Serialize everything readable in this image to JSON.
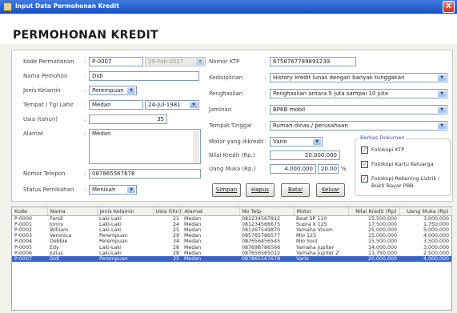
{
  "window": {
    "title": "Input Data Permohonan Kredit",
    "close_symbol": "X"
  },
  "page_title": "PERMOHONAN KREDIT",
  "left_form": {
    "kode": {
      "label": "Kode Permohonan",
      "value": "P-0007",
      "date_value": "25-Feb-2017"
    },
    "nama": {
      "label": "Nama Pemohon",
      "value": "Didi"
    },
    "jenis_kelamin": {
      "label": "Jenis Kelamin",
      "value": "Perempuan"
    },
    "ttl": {
      "label": "Tempat / Tgl Lahir",
      "tempat": "Medan",
      "tanggal": "24-Jul-1981"
    },
    "usia": {
      "label": "Usia (tahun)",
      "value": "35"
    },
    "alamat": {
      "label": "Alamat",
      "value": "Medan"
    },
    "telepon": {
      "label": "Nomor Telepon",
      "value": "087865567678"
    },
    "status": {
      "label": "Status Pernikahan",
      "value": "Menikah"
    }
  },
  "right_form": {
    "ktp": {
      "label": "Nomor KTP",
      "value": "6758767789891239"
    },
    "kedisiplinan": {
      "label": "Kedisiplinan",
      "value": "History kredit lunas dengan banyak tunggakan"
    },
    "penghasilan": {
      "label": "Penghasilan",
      "value": "Penghasilan antara 5 juta sampai 10 juta"
    },
    "jaminan": {
      "label": "Jaminan",
      "value": "BPKB mobil"
    },
    "tempat_tinggal": {
      "label": "Tempat Tinggal",
      "value": "Rumah dinas / perusahaan"
    },
    "motor": {
      "label": "Motor yang dikredit",
      "value": "Vario"
    },
    "nilai_kredit": {
      "label": "Nilai Kredit (Rp.)",
      "value": "20.000.000"
    },
    "uang_muka": {
      "label": "Uang Muka (Rp.)",
      "value": "4.000.000",
      "percent": "20.00",
      "percent_sign": "%"
    }
  },
  "buttons": {
    "simpan": "Simpan",
    "hapus": "Hapus",
    "batal": "Batal",
    "keluar": "Keluar"
  },
  "berkas": {
    "title": "Berkas Dokumen",
    "items": [
      {
        "label": "Fotokopi KTP",
        "checked": true
      },
      {
        "label": "Fotokopi Kartu Keluarga",
        "checked": true
      },
      {
        "label": "Fotokopi Rekening Listrik / Bukti Bayar PBB",
        "checked": true
      }
    ],
    "check_symbol": "✓"
  },
  "table": {
    "columns": [
      "Kode",
      "Nama",
      "Jenis Kelamin",
      "Usia (thn)",
      "Alamat",
      "No Telp",
      "Motor",
      "Nilai Kredit (Rp)",
      "Uang Muka (Rp)"
    ],
    "rows": [
      [
        "P-0000",
        "Fendi",
        "Laki-Laki",
        "21",
        "Medan",
        "081234567812",
        "Beat SP 110",
        "15,500,000",
        "3,000,000"
      ],
      [
        "P-0001",
        "Jonny",
        "Laki-Laki",
        "24",
        "Medan",
        "081234566675",
        "Supra X 125",
        "17,500,000",
        "1,750,000"
      ],
      [
        "P-0002",
        "William",
        "Laki-Laki",
        "25",
        "Medan",
        "081267549870",
        "Yamaha Vixion",
        "25,000,000",
        "5,000,000"
      ],
      [
        "P-0003",
        "Veronica",
        "Perempuan",
        "29",
        "Medan",
        "085765786577",
        "Mio 125",
        "15,000,000",
        "4,000,000"
      ],
      [
        "P-0004",
        "Debbie",
        "Perempuan",
        "34",
        "Medan",
        "087656456545",
        "Mio Soul",
        "15,500,000",
        "3,500,000"
      ],
      [
        "P-0005",
        "Edy",
        "Laki-Laki",
        "28",
        "Medan",
        "087698786566",
        "Yamaha Jupiter",
        "14,000,000",
        "3,000,000"
      ],
      [
        "P-0006",
        "Julius",
        "Laki-Laki",
        "28",
        "Medan",
        "087656565012",
        "Yamaha Jupiter Z",
        "13,750,000",
        "2,500,000"
      ],
      [
        "P-0007",
        "Didi",
        "Perempuan",
        "35",
        "Medan",
        "087865567678",
        "Vario",
        "20,000,000",
        "4,000,000"
      ]
    ],
    "selected_row": 7
  },
  "icons": {
    "dropdown": "chevron-down-icon",
    "window": "app-icon",
    "close": "close-icon"
  },
  "colors": {
    "titlebar": "#1c54c4",
    "selection": "#3a64c5",
    "close": "#c4361e",
    "group_title": "#3a4e9a"
  }
}
